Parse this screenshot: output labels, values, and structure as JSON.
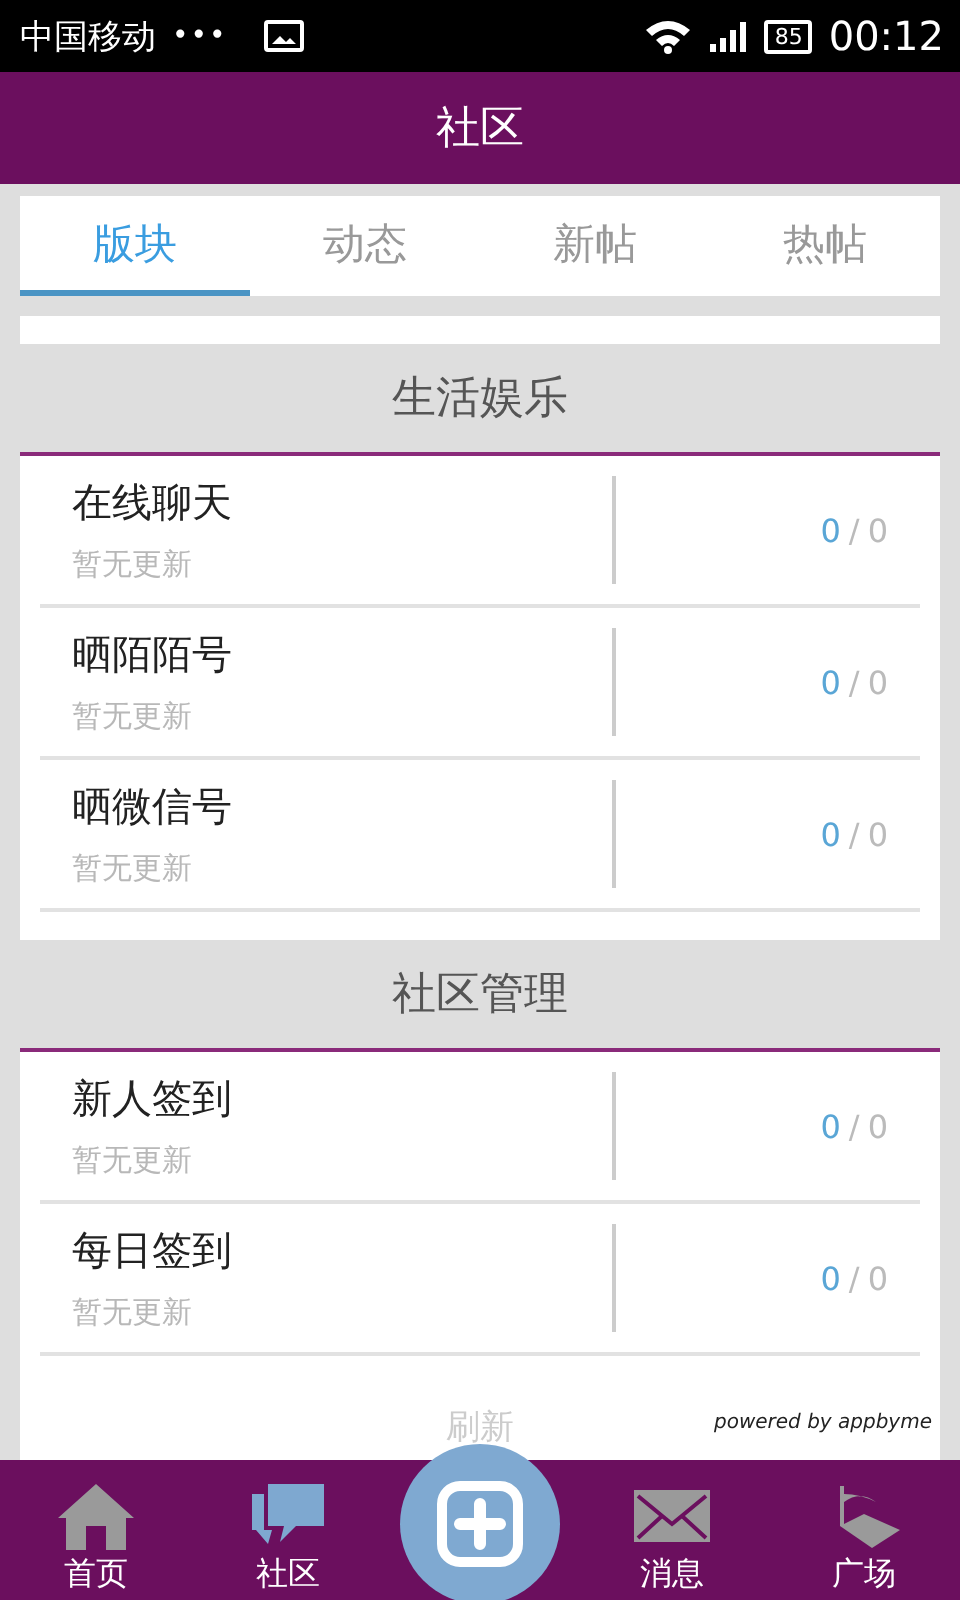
{
  "status_bar": {
    "carrier": "中国移动",
    "dots": "•••",
    "battery": "85",
    "time": "00:12"
  },
  "header": {
    "title": "社区"
  },
  "tabs": [
    {
      "label": "版块",
      "selected": true
    },
    {
      "label": "动态",
      "selected": false
    },
    {
      "label": "新帖",
      "selected": false
    },
    {
      "label": "热帖",
      "selected": false
    }
  ],
  "sections": [
    {
      "title": "生活娱乐",
      "boards": [
        {
          "name": "在线聊天",
          "subtitle": "暂无更新",
          "today": "0",
          "total": "0"
        },
        {
          "name": "晒陌陌号",
          "subtitle": "暂无更新",
          "today": "0",
          "total": "0"
        },
        {
          "name": "晒微信号",
          "subtitle": "暂无更新",
          "today": "0",
          "total": "0"
        }
      ]
    },
    {
      "title": "社区管理",
      "boards": [
        {
          "name": "新人签到",
          "subtitle": "暂无更新",
          "today": "0",
          "total": "0"
        },
        {
          "name": "每日签到",
          "subtitle": "暂无更新",
          "today": "0",
          "total": "0"
        }
      ]
    }
  ],
  "count_separator": "/",
  "refresh": "刷新",
  "powered_by": "powered by appbyme",
  "bottom_nav": [
    {
      "kind": "home",
      "label": "首页",
      "selected": false
    },
    {
      "kind": "chat",
      "label": "社区",
      "selected": true
    },
    {
      "kind": "plus"
    },
    {
      "kind": "mail",
      "label": "消息",
      "selected": false
    },
    {
      "kind": "flag",
      "label": "广场",
      "selected": false
    }
  ]
}
